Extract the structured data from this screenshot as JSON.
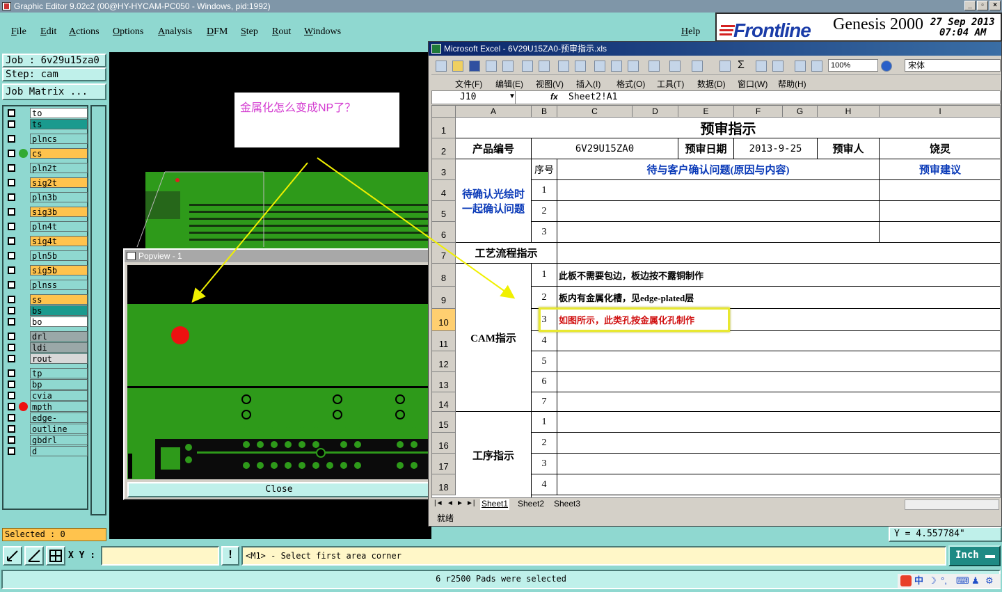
{
  "window": {
    "title": "Graphic Editor 9.02c2 (00@HY-HYCAM-PC050 - Windows, pid:1992)"
  },
  "menubar": {
    "items": [
      "File",
      "Edit",
      "Actions",
      "Options",
      "Analysis",
      "DFM",
      "Step",
      "Rout",
      "Windows"
    ],
    "help": "Help"
  },
  "brand": {
    "logo": "Frontline",
    "product": "Genesis 2000",
    "date": "27 Sep 2013",
    "time": "07:04 AM"
  },
  "left_panel": {
    "job": "Job : 6v29u15za0",
    "step": "Step: cam",
    "job_matrix": "Job Matrix ...",
    "selected": "Selected : 0",
    "layers": [
      {
        "name": "to",
        "color": "#ffffff",
        "dot": ""
      },
      {
        "name": "ts",
        "color": "#1a9a8e",
        "dot": ""
      },
      {
        "name": "plncs",
        "color": "#8fd8d0",
        "dot": ""
      },
      {
        "name": "cs",
        "color": "#ffc34d",
        "dot": "#33aa33"
      },
      {
        "name": "pln2t",
        "color": "#8fd8d0",
        "dot": ""
      },
      {
        "name": "sig2t",
        "color": "#ffc34d",
        "dot": ""
      },
      {
        "name": "pln3b",
        "color": "#8fd8d0",
        "dot": ""
      },
      {
        "name": "sig3b",
        "color": "#ffc34d",
        "dot": ""
      },
      {
        "name": "pln4t",
        "color": "#8fd8d0",
        "dot": ""
      },
      {
        "name": "sig4t",
        "color": "#ffc34d",
        "dot": ""
      },
      {
        "name": "pln5b",
        "color": "#8fd8d0",
        "dot": ""
      },
      {
        "name": "sig5b",
        "color": "#ffc34d",
        "dot": ""
      },
      {
        "name": "plnss",
        "color": "#8fd8d0",
        "dot": ""
      },
      {
        "name": "ss",
        "color": "#ffc34d",
        "dot": ""
      },
      {
        "name": "bs",
        "color": "#1a9a8e",
        "dot": ""
      },
      {
        "name": "bo",
        "color": "#ffffff",
        "dot": ""
      },
      {
        "name": "drl",
        "color": "#9aa8a8",
        "dot": ""
      },
      {
        "name": "ldi",
        "color": "#9aa8a8",
        "dot": ""
      },
      {
        "name": "rout",
        "color": "#d8d8d8",
        "dot": ""
      },
      {
        "name": "tp",
        "color": "#8fd8d0",
        "dot": ""
      },
      {
        "name": "bp",
        "color": "#8fd8d0",
        "dot": ""
      },
      {
        "name": "cvia",
        "color": "#8fd8d0",
        "dot": ""
      },
      {
        "name": "mpth",
        "color": "#8fd8d0",
        "dot": "#ee1111"
      },
      {
        "name": "edge-plated",
        "color": "#8fd8d0",
        "dot": ""
      },
      {
        "name": "outline",
        "color": "#8fd8d0",
        "dot": ""
      },
      {
        "name": "gbdrl",
        "color": "#8fd8d0",
        "dot": ""
      },
      {
        "name": "d",
        "color": "#8fd8d0",
        "dot": ""
      }
    ]
  },
  "annotation": {
    "text": "金属化怎么变成NP了？"
  },
  "popview": {
    "title": "Popview - 1",
    "close_label": "Close"
  },
  "excel": {
    "title": "Microsoft Excel - 6V29U15ZA0-预审指示.xls",
    "zoom": "100%",
    "font": "宋体",
    "menus": [
      "文件(F)",
      "编辑(E)",
      "视图(V)",
      "插入(I)",
      "格式(O)",
      "工具(T)",
      "数据(D)",
      "窗口(W)",
      "帮助(H)"
    ],
    "name_box": "J10",
    "formula": "Sheet2!A1",
    "columns": [
      "A",
      "B",
      "C",
      "D",
      "E",
      "F",
      "G",
      "H",
      "I"
    ],
    "rows": [
      "1",
      "2",
      "3",
      "4",
      "5",
      "6",
      "7",
      "8",
      "9",
      "10",
      "11",
      "12",
      "13",
      "14",
      "15",
      "16",
      "17",
      "18"
    ],
    "sheet_title": "预审指示",
    "product_label": "产品编号",
    "product_value": "6V29U15ZA0",
    "review_date_label": "预审日期",
    "review_date_value": "2013-9-25",
    "reviewer_label": "预审人",
    "reviewer_value": "饶灵",
    "seq_label": "序号",
    "issue_header": "待与客户确认问题(原因与内容)",
    "suggest_header": "预审建议",
    "confirm_label": "待确认光绘时一起确认问题",
    "process_label": "工艺流程指示",
    "cam_label": "CAM指示",
    "procedure_label": "工序指示",
    "confirm_seq": [
      "1",
      "2",
      "3"
    ],
    "cam_seq": [
      "1",
      "2",
      "3",
      "4",
      "5",
      "6",
      "7"
    ],
    "cam_items": [
      "此板不需要包边，板边按不露铜制作",
      "板内有金属化槽，见edge-plated层",
      "如图所示，此类孔按金属化孔制作"
    ],
    "procedure_seq": [
      "1",
      "2",
      "3",
      "4"
    ],
    "sheet_tabs": [
      "Sheet1",
      "Sheet2",
      "Sheet3"
    ],
    "status": "就绪"
  },
  "bottom": {
    "y_coord": "Y = 4.557784\"",
    "xy_label": "X Y :",
    "xy_value": "",
    "prompt": "<M1> - Select first area corner",
    "units": "Inch",
    "message": "6 r2500 Pads were selected",
    "ime": "中"
  }
}
